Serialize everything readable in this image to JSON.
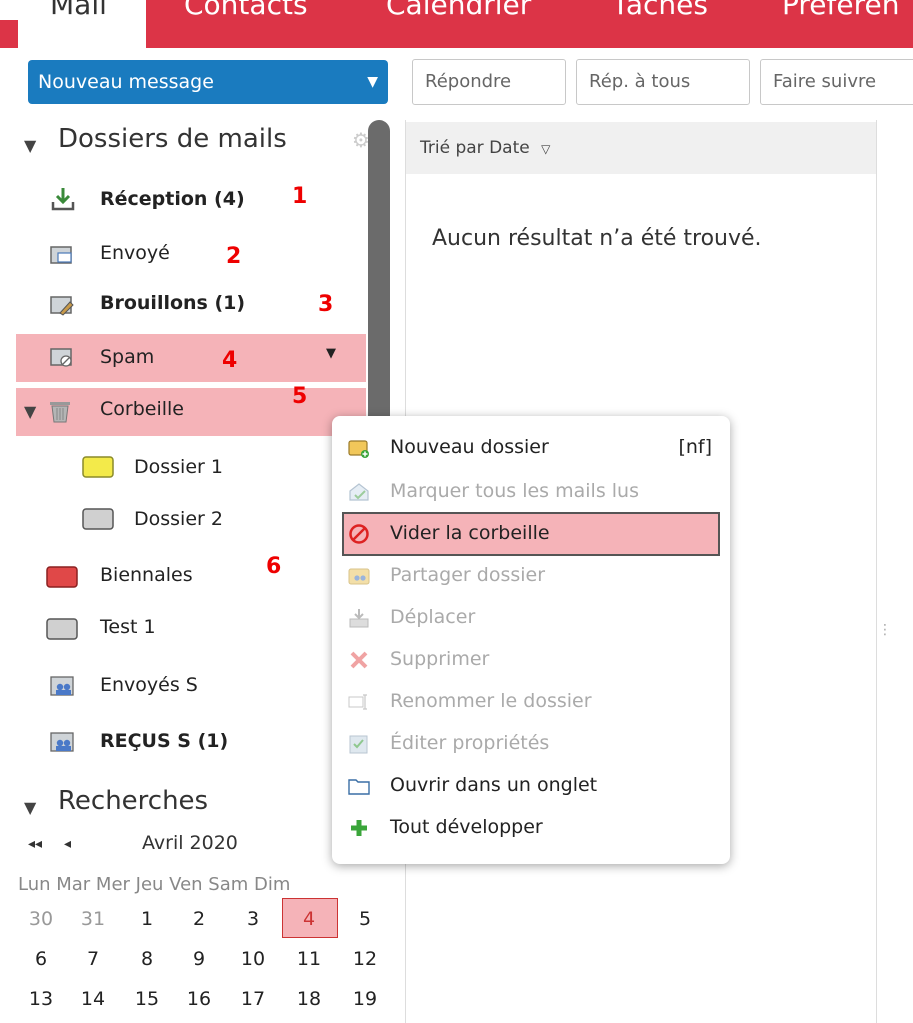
{
  "tabs": {
    "mail": "Mail",
    "contacts": "Contacts",
    "calendar": "Calendrier",
    "tasks": "Tâches",
    "preferences": "Préféren"
  },
  "toolbar": {
    "new_message": "Nouveau message",
    "reply": "Répondre",
    "reply_all": "Rép. à tous",
    "forward": "Faire suivre"
  },
  "folders": {
    "section_title": "Dossiers de mails",
    "items": [
      {
        "label": "Réception (4)",
        "bold": true,
        "annotation": "1"
      },
      {
        "label": "Envoyé",
        "bold": false,
        "annotation": "2"
      },
      {
        "label": "Brouillons (1)",
        "bold": true,
        "annotation": "3"
      },
      {
        "label": "Spam",
        "bold": false,
        "annotation": "4"
      },
      {
        "label": "Corbeille",
        "bold": false,
        "annotation": "5"
      },
      {
        "label": "Dossier 1",
        "bold": false
      },
      {
        "label": "Dossier 2",
        "bold": false
      },
      {
        "label": "Biennales",
        "bold": false,
        "annotation": "6"
      },
      {
        "label": "Test 1",
        "bold": false
      },
      {
        "label": "Envoyés S",
        "bold": false
      },
      {
        "label": "REÇUS S (1)",
        "bold": true
      }
    ]
  },
  "searches": {
    "section_title": "Recherches"
  },
  "calendar": {
    "month": "Avril 2020",
    "nav_first": "◂◂",
    "nav_prev": "◂",
    "weekdays": "Lun Mar Mer Jeu Ven Sam Dim",
    "rows": [
      [
        "30",
        "31",
        "1",
        "2",
        "3",
        "4",
        "5"
      ],
      [
        "6",
        "7",
        "8",
        "9",
        "10",
        "11",
        "12"
      ],
      [
        "13",
        "14",
        "15",
        "16",
        "17",
        "18",
        "19"
      ]
    ],
    "today": "4"
  },
  "list": {
    "sort_label": "Trié par Date",
    "empty_text": "Aucun résultat n’a été trouvé."
  },
  "context_menu": {
    "items": [
      {
        "label": "Nouveau dossier",
        "shortcut": "[nf]",
        "enabled": true,
        "icon": "new-folder-icon"
      },
      {
        "label": "Marquer tous les mails lus",
        "enabled": false,
        "icon": "mark-read-icon"
      },
      {
        "label": "Vider la corbeille",
        "enabled": true,
        "highlighted": true,
        "icon": "prohibited-icon"
      },
      {
        "label": "Partager dossier",
        "enabled": false,
        "icon": "share-folder-icon"
      },
      {
        "label": "Déplacer",
        "enabled": false,
        "icon": "move-icon"
      },
      {
        "label": "Supprimer",
        "enabled": false,
        "icon": "delete-x-icon"
      },
      {
        "label": "Renommer le dossier",
        "enabled": false,
        "icon": "rename-icon"
      },
      {
        "label": "Éditer propriétés",
        "enabled": false,
        "icon": "edit-properties-icon"
      },
      {
        "label": "Ouvrir dans un onglet",
        "enabled": true,
        "icon": "open-tab-icon"
      },
      {
        "label": "Tout développer",
        "enabled": true,
        "icon": "expand-plus-icon"
      }
    ]
  },
  "colors": {
    "accent_red": "#dc3447",
    "selection_pink": "#f5b3b8",
    "primary_blue": "#1a7bbf",
    "annotation_red": "#e00000"
  }
}
